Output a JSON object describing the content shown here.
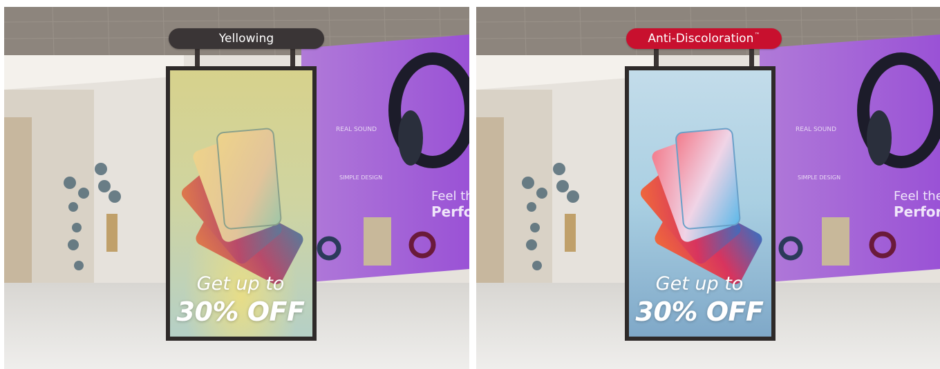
{
  "panels": {
    "left": {
      "badge_label": "Yellowing",
      "promo_line1": "Get up to",
      "promo_line2": "30% OFF",
      "wall_text_1": "REAL SOUND",
      "wall_text_2": "SIMPLE DESIGN",
      "wall_text_3": "Feel the",
      "wall_text_4": "Perfor",
      "badge_color": "#3a3536",
      "screen_tint": "#c9cf93"
    },
    "right": {
      "badge_label": "Anti-Discoloration",
      "badge_mark": "™",
      "promo_line1": "Get up to",
      "promo_line2": "30% OFF",
      "wall_text_1": "REAL SOUND",
      "wall_text_2": "SIMPLE DESIGN",
      "wall_text_3": "Feel the",
      "wall_text_4": "Perfor",
      "badge_color": "#c8102e",
      "screen_tint": "#a9cde0"
    }
  }
}
